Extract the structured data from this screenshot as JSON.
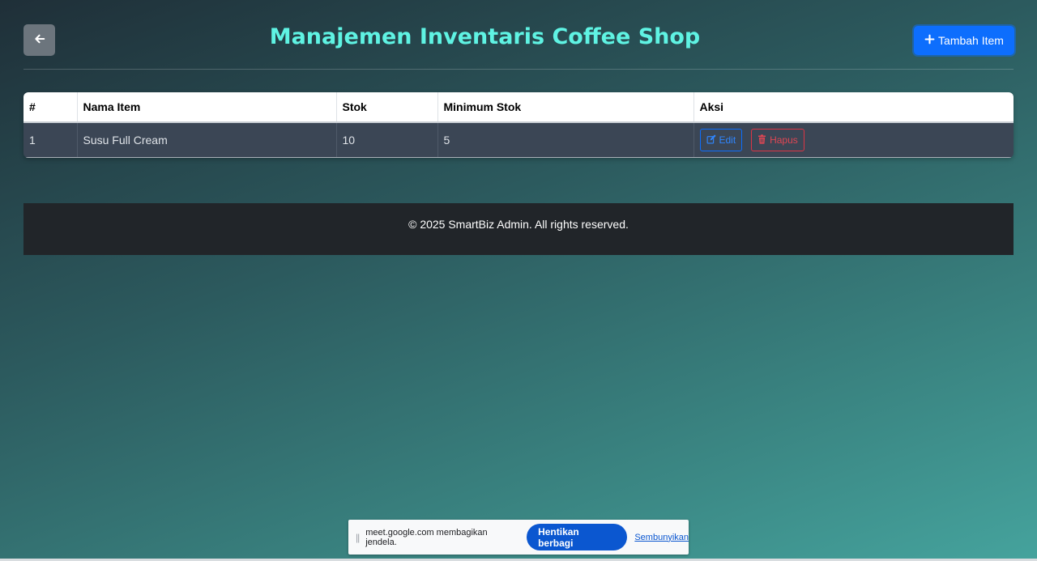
{
  "header": {
    "title": "Manajemen Inventaris Coffee Shop",
    "back_icon": "arrow-left-icon",
    "add_button_label": "Tambah Item",
    "add_icon": "plus-icon"
  },
  "table": {
    "columns": [
      "#",
      "Nama Item",
      "Stok",
      "Minimum Stok",
      "Aksi"
    ],
    "rows": [
      {
        "no": "1",
        "name": "Susu Full Cream",
        "stock": "10",
        "min_stock": "5",
        "edit_label": "Edit",
        "delete_label": "Hapus"
      }
    ]
  },
  "footer": {
    "text": "© 2025 SmartBiz Admin. All rights reserved."
  },
  "share_bar": {
    "message": "meet.google.com membagikan jendela.",
    "stop_label": "Hentikan berbagi",
    "hide_label": "Sembunyikan"
  },
  "colors": {
    "title": "#5ff3e3",
    "primary": "#0d6efd",
    "danger": "#dc3545",
    "back_button": "#6c757d",
    "footer_bg": "#212529",
    "row_bg": "#3b4655"
  }
}
